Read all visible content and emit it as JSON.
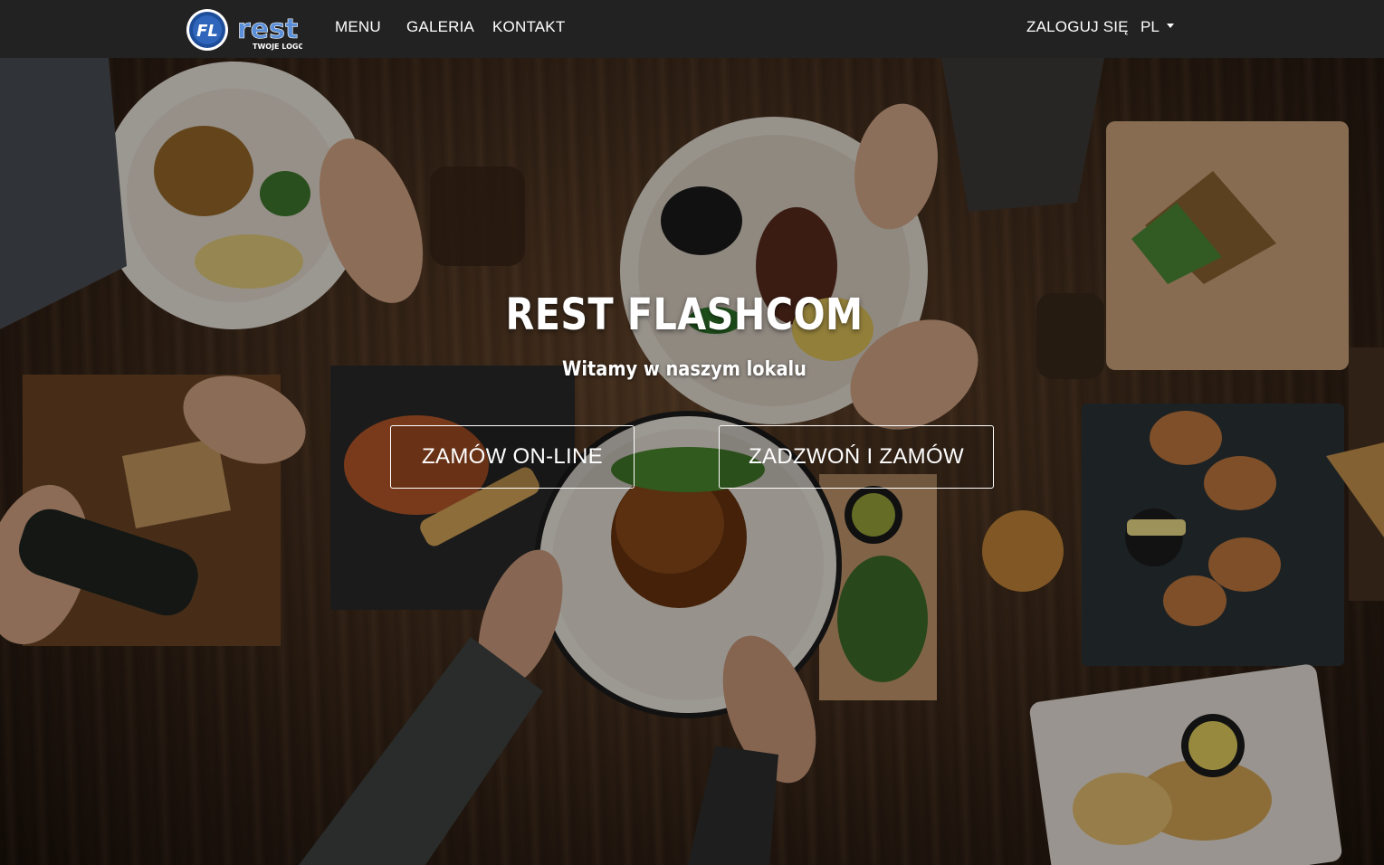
{
  "navbar": {
    "logo": {
      "badge_text": "FL",
      "wordmark": "rest",
      "tagline": "TWOJE LOGO"
    },
    "links": [
      "MENU",
      "GALERIA",
      "KONTAKT"
    ],
    "login_label": "ZALOGUJ SIĘ",
    "language": "PL"
  },
  "hero": {
    "title": "REST FLASHCOM",
    "subtitle": "Witamy w naszym lokalu",
    "order_online_label": "ZAMÓW ON-LINE",
    "call_order_label": "ZADZWOŃ I ZAMÓW"
  },
  "colors": {
    "navbar_bg": "#222222",
    "logo_blue": "#1e4e9a",
    "text": "#ffffff"
  }
}
